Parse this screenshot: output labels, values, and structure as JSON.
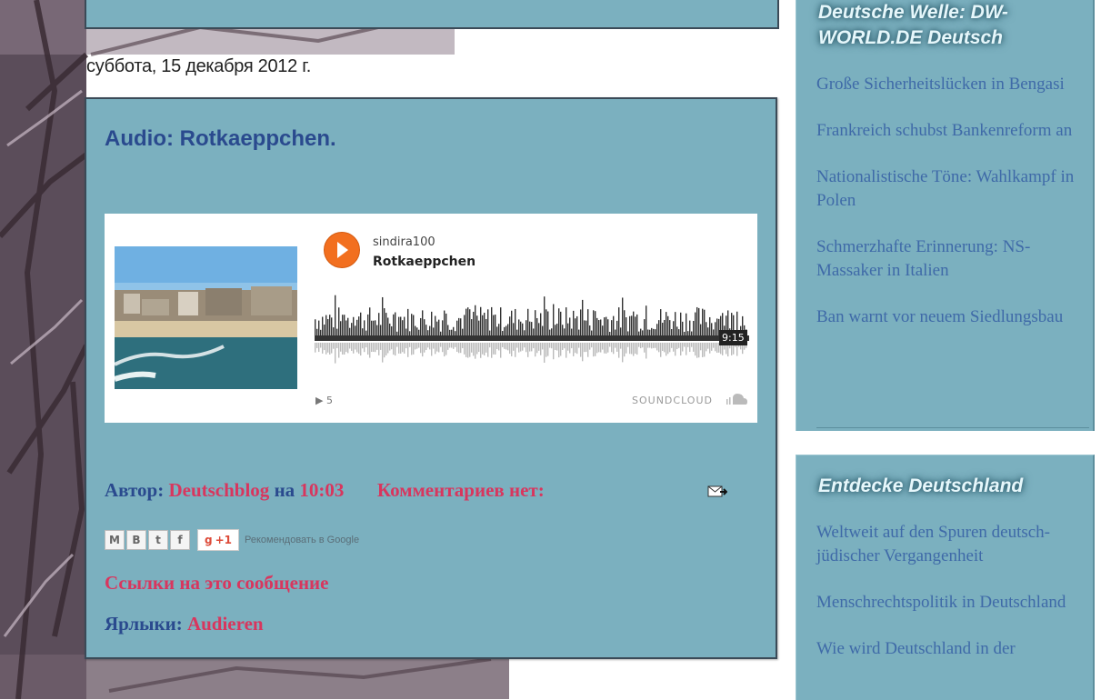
{
  "date_header": "суббота, 15 декабря 2012 г.",
  "post": {
    "title": "Audio: Rotkaeppchen.",
    "player": {
      "user": "sindira100",
      "track": "Rotkaeppchen",
      "duration": "9:15",
      "plays": "5",
      "brand": "SOUNDCLOUD"
    },
    "meta": {
      "author_label": "Автор:",
      "author": "Deutschblog",
      "at_label": "на",
      "time": "10:03",
      "comments": "Комментариев нет:"
    },
    "share": {
      "buttons": [
        "M",
        "B",
        "t",
        "f"
      ],
      "gplus": "+1",
      "recommend": "Рекомендовать в Google"
    },
    "links_to_post": "Ссылки на это сообщение",
    "labels_label": "Ярлыки:",
    "label": "Audieren"
  },
  "sidebar": {
    "widget1": {
      "title": "Deutsche Welle: DW-WORLD.DE Deutsch",
      "items": [
        "Große Sicherheitslücken in Bengasi",
        "Frankreich schubst Bankenreform an",
        "Nationalistische Töne: Wahlkampf in Polen",
        "Schmerzhafte Erinnerung: NS-Massaker in Italien",
        "Ban warnt vor neuem Siedlungsbau"
      ]
    },
    "widget2": {
      "title": "Entdecke Deutschland",
      "items": [
        "Weltweit auf den Spuren deutsch-jüdischer Vergangenheit",
        "Menschrechtspolitik in Deutschland",
        "Wie wird Deutschland in der"
      ]
    }
  },
  "colors": {
    "panel": "#7bb0bf",
    "title_blue": "#2a4a8e",
    "link_pink": "#d8365e",
    "soundcloud_orange": "#f26f1f"
  }
}
